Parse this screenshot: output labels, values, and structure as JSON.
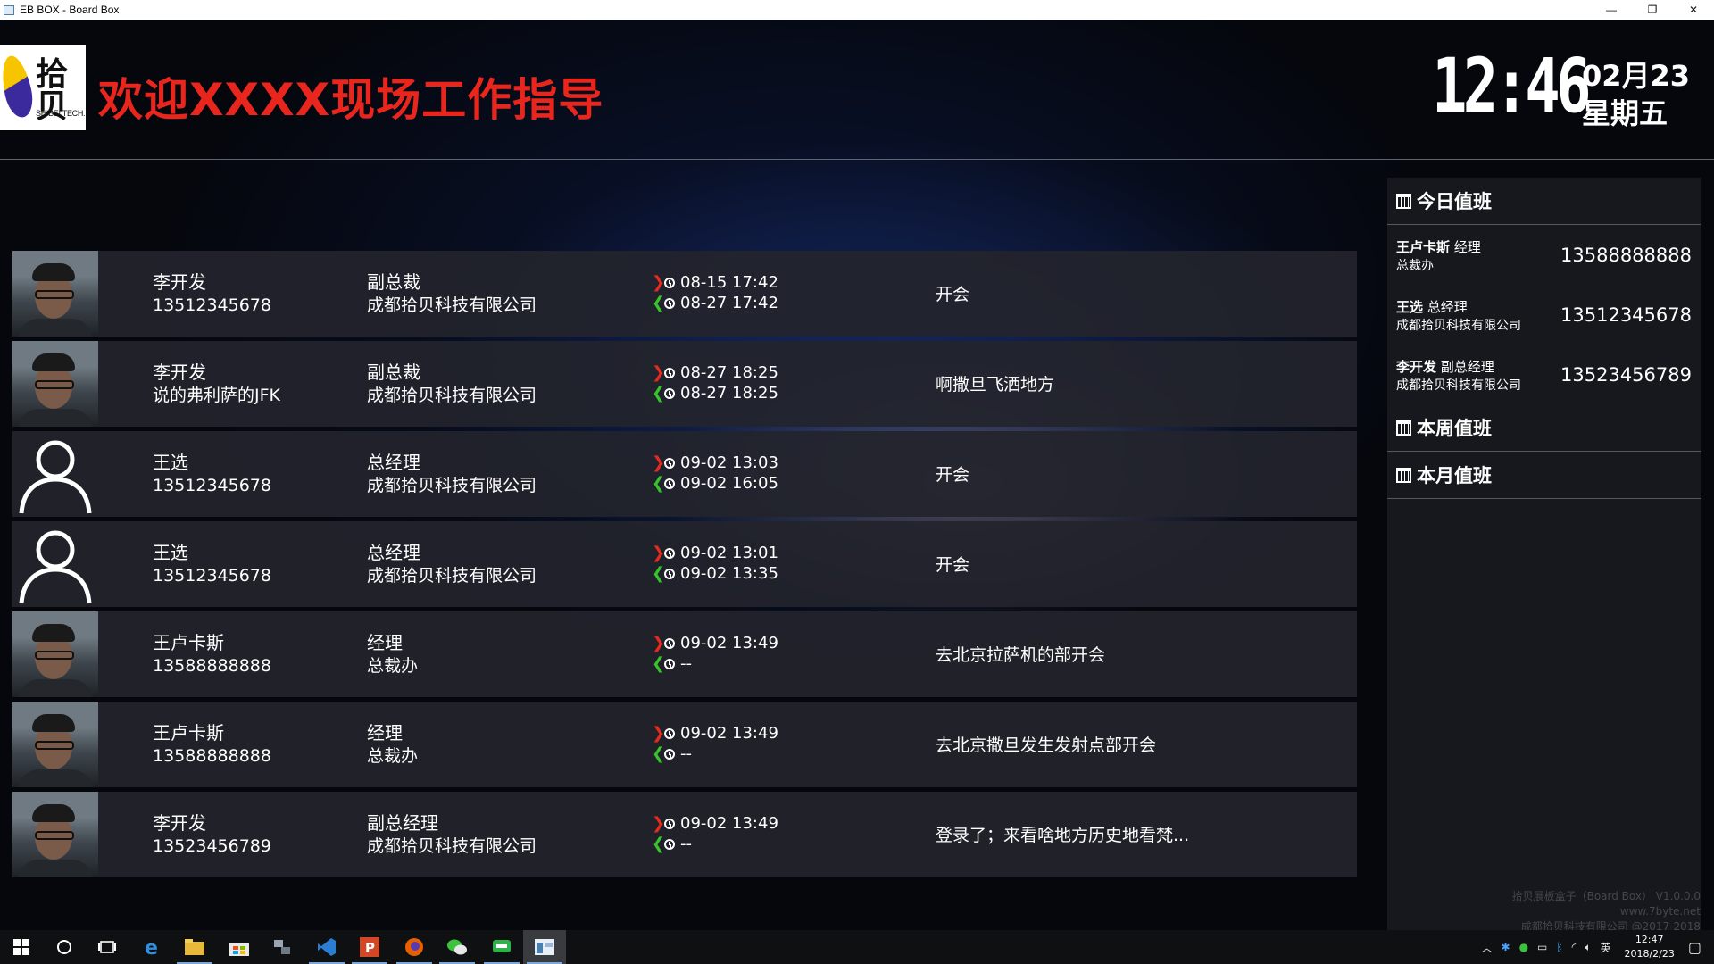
{
  "window": {
    "title": "EB BOX - Board Box",
    "minimize": "—",
    "restore": "❐",
    "close": "✕"
  },
  "header": {
    "logo_text": "拾贝",
    "logo_sub": "SHIBEI TECH.",
    "headline": "欢迎XXXX现场工作指导",
    "time": "12:46",
    "date": "02月23",
    "weekday": "星期五"
  },
  "visitors": [
    {
      "photo": "camera-photo",
      "name": "李开发",
      "contact": "13512345678",
      "title": "副总裁",
      "company": "成都拾贝科技有限公司",
      "time_in": "08-15 17:42",
      "time_out": "08-27 17:42",
      "reason": "开会"
    },
    {
      "photo": "camera-photo",
      "name": "李开发",
      "contact": "说的弗利萨的JFK",
      "title": "副总裁",
      "company": "成都拾贝科技有限公司",
      "time_in": "08-27 18:25",
      "time_out": "08-27 18:25",
      "reason": "啊撒旦飞洒地方"
    },
    {
      "photo": "default-avatar",
      "name": "王选",
      "contact": "13512345678",
      "title": "总经理",
      "company": "成都拾贝科技有限公司",
      "time_in": "09-02 13:03",
      "time_out": "09-02 16:05",
      "reason": "开会"
    },
    {
      "photo": "default-avatar",
      "name": "王选",
      "contact": "13512345678",
      "title": "总经理",
      "company": "成都拾贝科技有限公司",
      "time_in": "09-02 13:01",
      "time_out": "09-02 13:35",
      "reason": "开会"
    },
    {
      "photo": "camera-photo",
      "name": "王卢卡斯",
      "contact": "13588888888",
      "title": "经理",
      "company": "总裁办",
      "time_in": "09-02 13:49",
      "time_out": "--",
      "reason": "去北京拉萨机的部开会"
    },
    {
      "photo": "camera-photo",
      "name": "王卢卡斯",
      "contact": "13588888888",
      "title": "经理",
      "company": "总裁办",
      "time_in": "09-02 13:49",
      "time_out": "--",
      "reason": "去北京撒旦发生发射点部开会"
    },
    {
      "photo": "camera-photo",
      "name": "李开发",
      "contact": "13523456789",
      "title": "副总经理",
      "company": "成都拾贝科技有限公司",
      "time_in": "09-02 13:49",
      "time_out": "--",
      "reason": "登录了；来看啥地方历史地看梵..."
    }
  ],
  "duty": {
    "today_label": "今日值班",
    "week_label": "本周值班",
    "month_label": "本月值班",
    "today": [
      {
        "name": "王卢卡斯",
        "role": "经理",
        "dept": "总裁办",
        "phone": "13588888888"
      },
      {
        "name": "王选",
        "role": "总经理",
        "dept": "成都拾贝科技有限公司",
        "phone": "13512345678"
      },
      {
        "name": "李开发",
        "role": "副总经理",
        "dept": "成都拾贝科技有限公司",
        "phone": "13523456789"
      }
    ],
    "footer": {
      "product": "拾贝展板盒子（Board Box） V1.0.0.0",
      "site": "www.7byte.net",
      "copyright": "成都拾贝科技有限公司 @2017-2018"
    }
  },
  "taskbar": {
    "icons": [
      "windows-start-icon",
      "search-circle-icon",
      "task-view-icon",
      "edge-icon",
      "file-explorer-icon",
      "store-icon",
      "network-tool-icon",
      "vscode-icon",
      "powerpoint-icon",
      "firefox-icon",
      "wechat-icon",
      "chat-app-icon",
      "board-box-icon"
    ],
    "tray_lang": "英",
    "tray_time": "12:47",
    "tray_date": "2018/2/23"
  },
  "colors": {
    "headline": "#e8261d",
    "arrow_in": "#e62a20",
    "arrow_out": "#36c42a",
    "row_bg": "#22242c",
    "panel_bg": "#17181d"
  }
}
